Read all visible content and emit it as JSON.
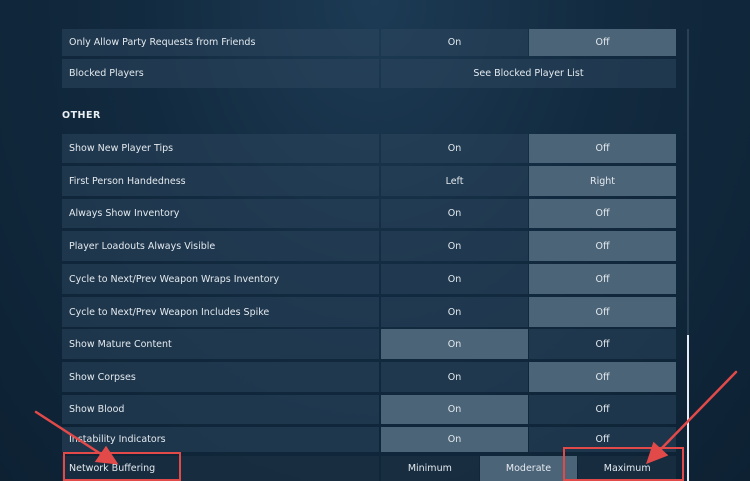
{
  "party_requests": {
    "label": "Only Allow Party Requests from Friends",
    "options": [
      "On",
      "Off"
    ],
    "selected": "Off"
  },
  "blocked_players": {
    "label": "Blocked Players",
    "button": "See Blocked Player List"
  },
  "section_other": "OTHER",
  "other_rows": [
    {
      "label": "Show New Player Tips",
      "options": [
        "On",
        "Off"
      ],
      "selected": "Off"
    },
    {
      "label": "First Person Handedness",
      "options": [
        "Left",
        "Right"
      ],
      "selected": "Right"
    },
    {
      "label": "Always Show Inventory",
      "options": [
        "On",
        "Off"
      ],
      "selected": "Off"
    },
    {
      "label": "Player Loadouts Always Visible",
      "options": [
        "On",
        "Off"
      ],
      "selected": "Off"
    },
    {
      "label": "Cycle to Next/Prev Weapon Wraps Inventory",
      "options": [
        "On",
        "Off"
      ],
      "selected": "Off"
    },
    {
      "label": "Cycle to Next/Prev Weapon Includes Spike",
      "options": [
        "On",
        "Off"
      ],
      "selected": "Off"
    },
    {
      "label": "Show Mature Content",
      "options": [
        "On",
        "Off"
      ],
      "selected": "On"
    },
    {
      "label": "Show Corpses",
      "options": [
        "On",
        "Off"
      ],
      "selected": "Off"
    },
    {
      "label": "Show Blood",
      "options": [
        "On",
        "Off"
      ],
      "selected": "On"
    },
    {
      "label": "Instability Indicators",
      "options": [
        "On",
        "Off"
      ],
      "selected": "On"
    }
  ],
  "network_buffering": {
    "label": "Network Buffering",
    "options": [
      "Minimum",
      "Moderate",
      "Maximum"
    ],
    "selected": "Moderate"
  },
  "colors": {
    "annotation": "#e24a4a",
    "selected_option": "#4c6478"
  }
}
